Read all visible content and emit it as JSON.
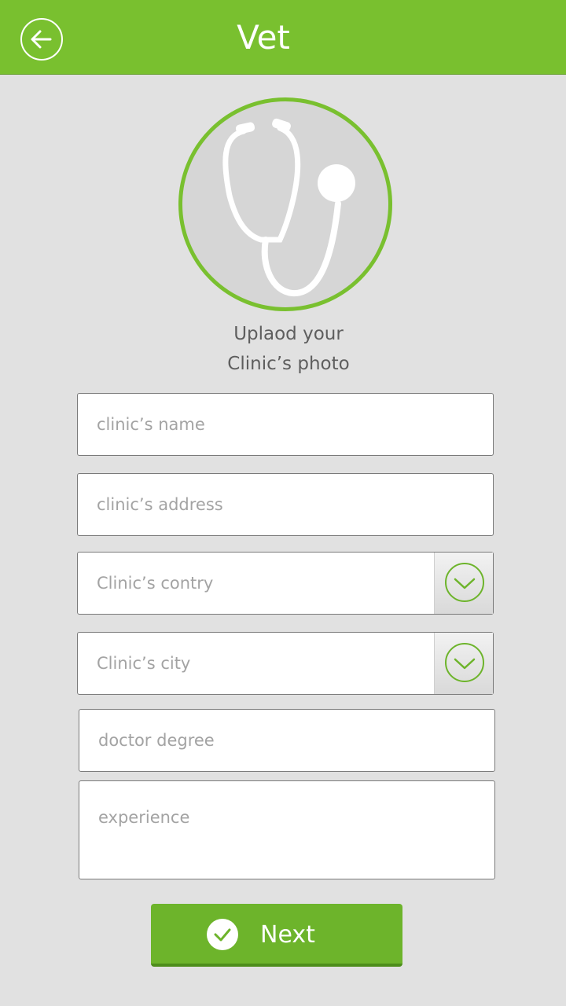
{
  "header": {
    "title": "Vet",
    "back_icon": "arrow-left-circle-icon",
    "color": "#79c02f"
  },
  "photo_upload": {
    "icon": "stethoscope-icon",
    "line1": "Uplaod your",
    "line2": "Clinic’s photo"
  },
  "form": {
    "clinic_name": {
      "placeholder": "clinic’s name",
      "value": ""
    },
    "clinic_address": {
      "placeholder": "clinic’s address",
      "value": ""
    },
    "clinic_country": {
      "placeholder": "Clinic’s contry",
      "icon": "chevron-down-circle-icon"
    },
    "clinic_city": {
      "placeholder": "Clinic’s city",
      "icon": "chevron-down-circle-icon"
    },
    "doctor_degree": {
      "placeholder": "doctor degree",
      "value": ""
    },
    "experience": {
      "placeholder": "experience",
      "value": ""
    }
  },
  "next_button": {
    "label": "Next",
    "icon": "checkmark-circle-icon",
    "color": "#6db42b"
  }
}
